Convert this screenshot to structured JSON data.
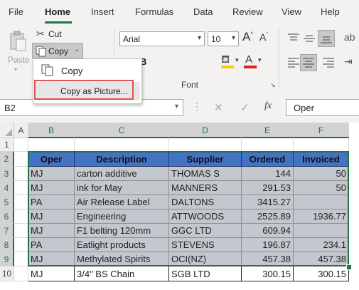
{
  "menu": {
    "tabs": [
      "File",
      "Home",
      "Insert",
      "Formulas",
      "Data",
      "Review",
      "View",
      "Help"
    ],
    "active": "Home"
  },
  "ribbon": {
    "paste_label": "Paste",
    "cut_label": "Cut",
    "copy_label": "Copy",
    "font_name": "Arial",
    "font_size": "10",
    "bold": "B",
    "font_group_label": "Font"
  },
  "popup": {
    "items": [
      "Copy",
      "Copy as Picture..."
    ]
  },
  "formula_bar": {
    "name_box": "B2",
    "fx": "fx",
    "content": "Oper"
  },
  "sheet": {
    "columns": [
      "A",
      "B",
      "C",
      "D",
      "E",
      "F"
    ],
    "rows": [
      "1",
      "2",
      "3",
      "4",
      "5",
      "6",
      "7",
      "8",
      "9",
      "10"
    ],
    "header": [
      "Oper",
      "Description",
      "Supplier",
      "Ordered",
      "Invoiced"
    ],
    "data": [
      [
        "MJ",
        "carton additive",
        "THOMAS S",
        "144",
        "50"
      ],
      [
        "MJ",
        "ink for May",
        "MANNERS",
        "291.53",
        "50"
      ],
      [
        "PA",
        "Air Release Label",
        "DALTONS",
        "3415.27",
        ""
      ],
      [
        "MJ",
        "Engineering",
        "ATTWOODS",
        "2525.89",
        "1936.77"
      ],
      [
        "MJ",
        "F1 belting 120mm",
        "GGC LTD",
        "609.94",
        ""
      ],
      [
        "PA",
        "Eatlight products",
        "STEVENS",
        "196.87",
        "234.1"
      ],
      [
        "MJ",
        "Methylated Spirits",
        "OCI(NZ)",
        "457.38",
        "457.38"
      ],
      [
        "MJ",
        "3/4\" BS Chain",
        "SGB LTD",
        "300.15",
        "300.15"
      ]
    ]
  },
  "colors": {
    "accent": "#217346",
    "header_fill": "#4472c4",
    "selection_fill": "#c4c7ce",
    "highlight_box": "#e05252"
  }
}
